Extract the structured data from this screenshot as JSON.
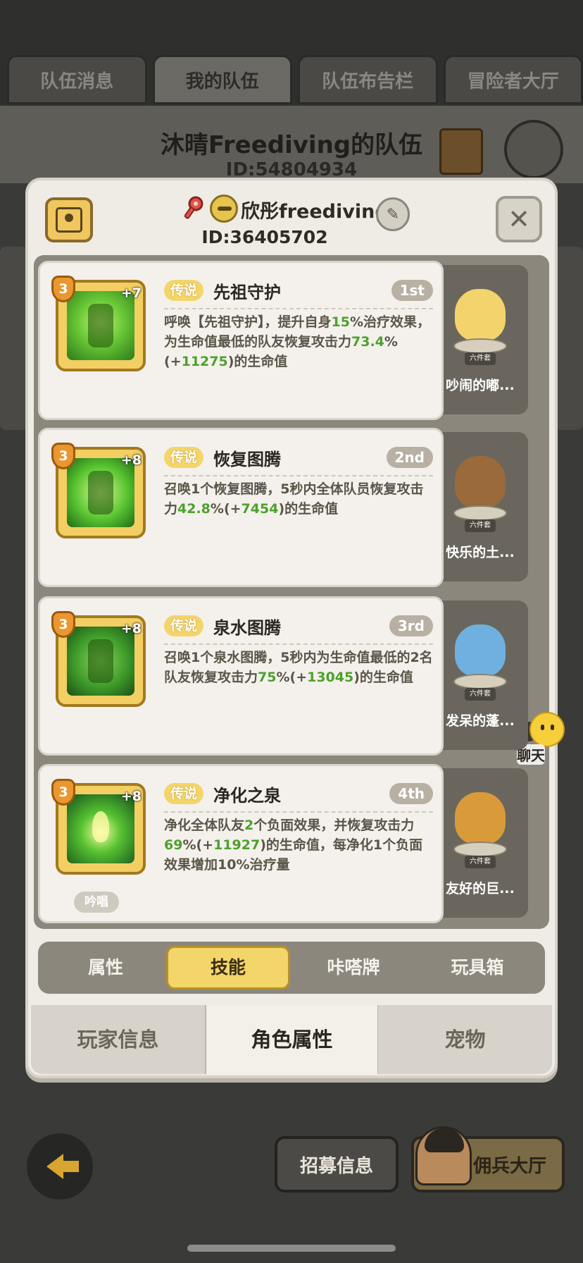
{
  "top_tabs": [
    "队伍消息",
    "我的队伍",
    "队伍布告栏",
    "冒险者大厅"
  ],
  "team": {
    "name": "沐晴Freediving的队伍",
    "id": "ID:54804934"
  },
  "player": {
    "name": "欣彤freediving",
    "id": "ID:36405702"
  },
  "close_label": "✕",
  "edit_pencil_glyph": "✎",
  "skills": [
    {
      "level": "3",
      "plus": "+7",
      "rarity": "传说",
      "name": "先祖守护",
      "rank": "1st",
      "desc": [
        {
          "t": "呼唤【先祖守护】，提升自身"
        },
        {
          "t": "15",
          "hl": true
        },
        {
          "t": "%治疗效果，为生命值最低的队友恢复攻击力"
        },
        {
          "t": "73.4",
          "hl": true
        },
        {
          "t": "%(+"
        },
        {
          "t": "11275",
          "hl": true
        },
        {
          "t": ")的生命值"
        }
      ],
      "pet_name": "吵闹的嘟...",
      "pet_badge": "六件套",
      "pet_color": "#f3d36b"
    },
    {
      "level": "3",
      "plus": "+8",
      "rarity": "传说",
      "name": "恢复图腾",
      "rank": "2nd",
      "desc": [
        {
          "t": "召唤1个恢复图腾，5秒内全体队员恢复攻击力"
        },
        {
          "t": "42.8",
          "hl": true
        },
        {
          "t": "%(+"
        },
        {
          "t": "7454",
          "hl": true
        },
        {
          "t": ")的生命值"
        }
      ],
      "pet_name": "快乐的土...",
      "pet_badge": "六件套",
      "pet_color": "#9a6a3a"
    },
    {
      "level": "3",
      "plus": "+8",
      "rarity": "传说",
      "name": "泉水图腾",
      "rank": "3rd",
      "desc": [
        {
          "t": "召唤1个泉水图腾，5秒内为生命值最低的2名队友恢复攻击力"
        },
        {
          "t": "75",
          "hl": true
        },
        {
          "t": "%(+"
        },
        {
          "t": "13045",
          "hl": true
        },
        {
          "t": ")的生命值"
        }
      ],
      "pet_name": "发呆的蓬...",
      "pet_badge": "六件套",
      "pet_color": "#6fb0e0"
    },
    {
      "level": "3",
      "plus": "+8",
      "rarity": "传说",
      "name": "净化之泉",
      "rank": "4th",
      "desc": [
        {
          "t": "净化全体队友"
        },
        {
          "t": "2",
          "hl": true
        },
        {
          "t": "个负面效果，并恢复攻击力"
        },
        {
          "t": "69",
          "hl": true
        },
        {
          "t": "%(+"
        },
        {
          "t": "11927",
          "hl": true
        },
        {
          "t": ")的生命值，每净化1个负面效果增加10%治疗量"
        }
      ],
      "chant": "吟唱",
      "pet_name": "友好的巨...",
      "pet_badge": "六件套",
      "pet_color": "#d99a3a"
    }
  ],
  "sub_tabs": [
    "属性",
    "技能",
    "咔嗒牌",
    "玩具箱"
  ],
  "main_tabs": [
    "玩家信息",
    "角色属性",
    "宠物"
  ],
  "chat_label": "聊天",
  "bottom": {
    "recruit": "招募信息",
    "mercenary": "佣兵大厅"
  },
  "colors": {
    "accent_gold": "#f3d56a",
    "highlight_green": "#4ca12d",
    "modal_bg": "#efece5"
  }
}
